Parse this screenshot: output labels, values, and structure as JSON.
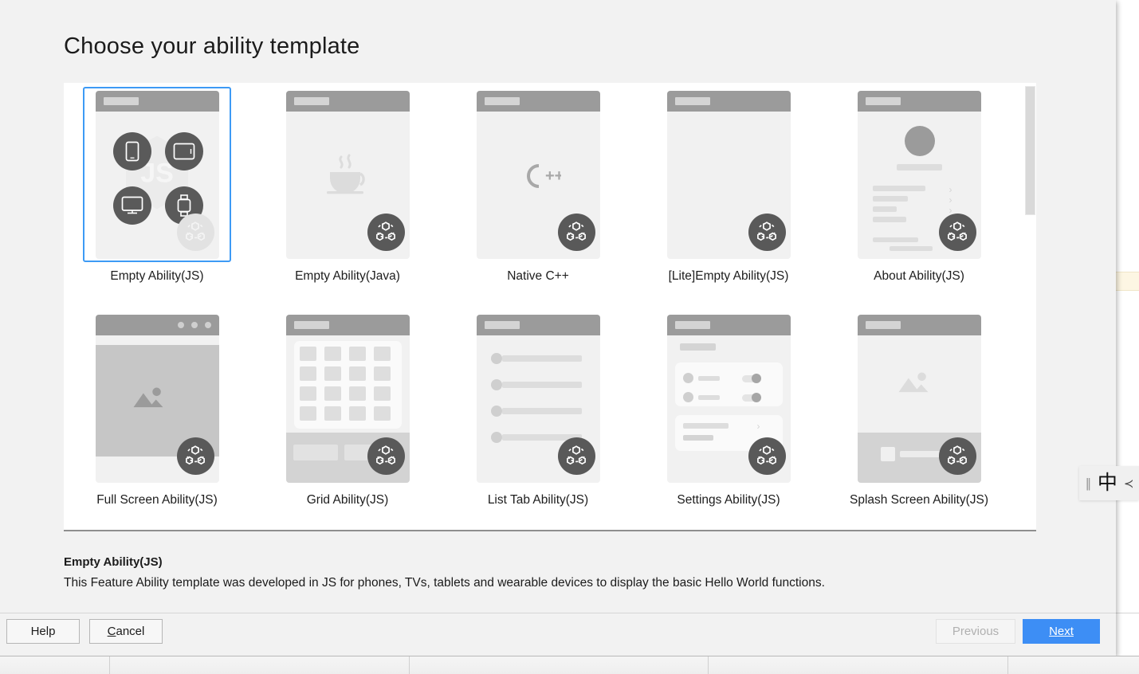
{
  "dialog": {
    "title": "Choose your ability template"
  },
  "templates": [
    {
      "id": "empty-ability-js",
      "label": "Empty Ability(JS)",
      "kind": "devices",
      "selected": true,
      "topbar": "dark"
    },
    {
      "id": "empty-ability-java",
      "label": "Empty Ability(Java)",
      "kind": "java",
      "selected": false,
      "topbar": "dark"
    },
    {
      "id": "native-cpp",
      "label": "Native C++",
      "kind": "cpp",
      "selected": false,
      "topbar": "dark"
    },
    {
      "id": "lite-empty-ability-js",
      "label": "[Lite]Empty Ability(JS)",
      "kind": "blank",
      "selected": false,
      "topbar": "dark"
    },
    {
      "id": "about-ability-js",
      "label": "About Ability(JS)",
      "kind": "about",
      "selected": false,
      "topbar": "dark"
    },
    {
      "id": "full-screen-ability-js",
      "label": "Full Screen Ability(JS)",
      "kind": "fullscreen",
      "selected": false,
      "topbar": "dark"
    },
    {
      "id": "grid-ability-js",
      "label": "Grid Ability(JS)",
      "kind": "grid",
      "selected": false,
      "topbar": "dark"
    },
    {
      "id": "list-tab-ability-js",
      "label": "List Tab Ability(JS)",
      "kind": "list",
      "selected": false,
      "topbar": "dark"
    },
    {
      "id": "settings-ability-js",
      "label": "Settings Ability(JS)",
      "kind": "settings",
      "selected": false,
      "topbar": "dark"
    },
    {
      "id": "splash-screen-ability-js",
      "label": "Splash Screen Ability(JS)",
      "kind": "splash",
      "selected": false,
      "topbar": "dark"
    }
  ],
  "description": {
    "title": "Empty Ability(JS)",
    "body": "This Feature Ability template was developed in JS for phones, TVs, tablets and wearable devices to display the basic Hello World functions."
  },
  "footer": {
    "help_label": "Help",
    "cancel_label": "Cancel",
    "cancel_mnemonic": "C",
    "cancel_rest": "ancel",
    "previous_label": "Previous",
    "next_mnemonic": "N",
    "next_rest": "ext",
    "next_label": "Next"
  },
  "ime": {
    "pipes": "||",
    "language": "中",
    "caret": "≺"
  },
  "colors": {
    "accent": "#3d8ef5",
    "selection_border": "#3d9af5",
    "dialog_bg": "#f2f2f2",
    "card_bg": "#f1f1f1",
    "topbar": "#9b9b9b",
    "badge": "#595959"
  }
}
